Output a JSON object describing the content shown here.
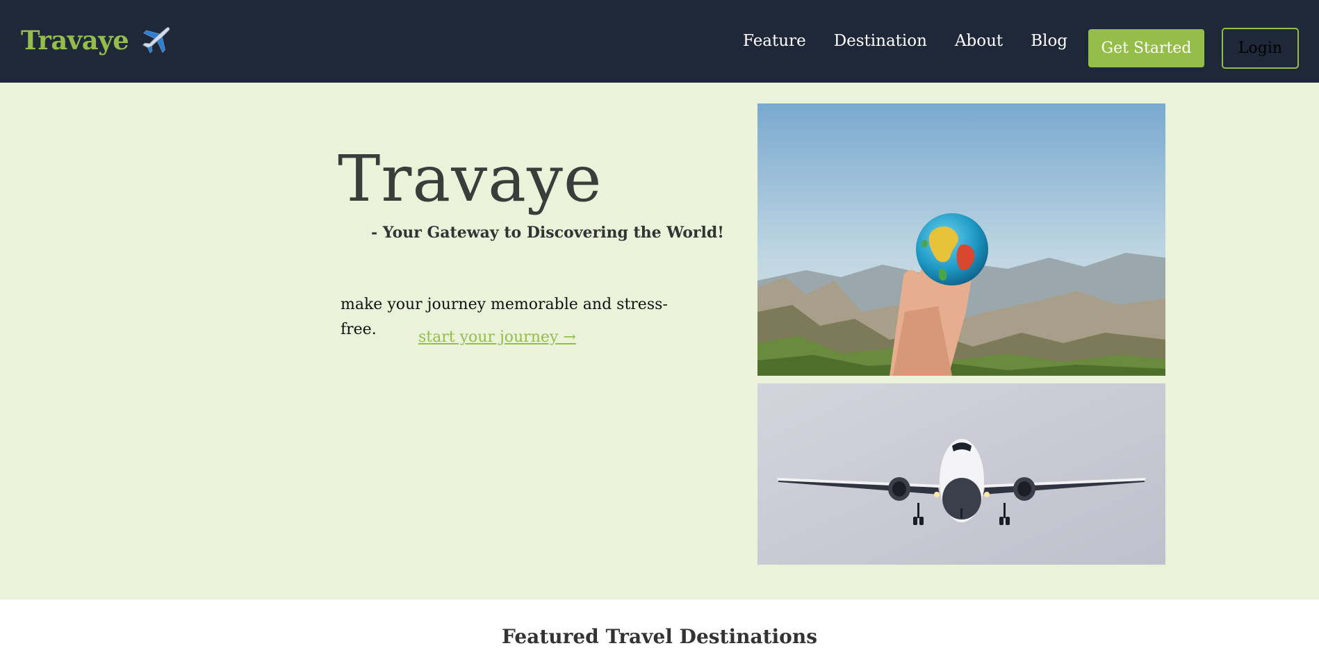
{
  "brand": {
    "name": "Travaye",
    "icon": "airplane-icon",
    "color": "#94bd49"
  },
  "nav": {
    "links": [
      "Feature",
      "Destination",
      "About",
      "Blog"
    ],
    "get_started_label": "Get Started",
    "login_label": "Login"
  },
  "hero": {
    "title": "Travaye",
    "tagline": "- Your Gateway to Discovering the World!",
    "description": "make your journey memorable and stress-free.",
    "cta": "start your journey →"
  },
  "images": {
    "top": "globe-in-hand-photo",
    "bottom": "airplane-photo"
  },
  "featured": {
    "title": "Featured Travel Destinations"
  },
  "colors": {
    "navbar": "#1f2839",
    "accent": "#94bd49",
    "hero_bg": "#eaf2da"
  }
}
